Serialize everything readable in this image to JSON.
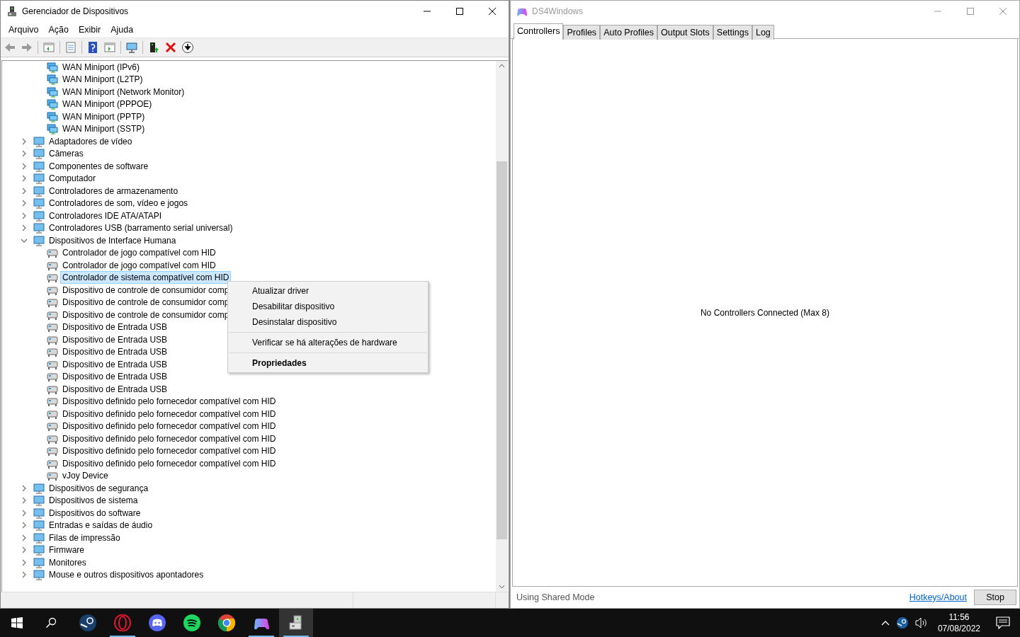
{
  "device_manager": {
    "title": "Gerenciador de Dispositivos",
    "menu": [
      "Arquivo",
      "Ação",
      "Exibir",
      "Ajuda"
    ],
    "tree": [
      {
        "children": [
          {
            "label": "WAN Miniport (IPv6)",
            "selected": false
          },
          {
            "label": "WAN Miniport (L2TP)",
            "selected": false
          },
          {
            "label": "WAN Miniport (Network Monitor)",
            "selected": false
          },
          {
            "label": "WAN Miniport (PPPOE)",
            "selected": false
          },
          {
            "label": "WAN Miniport (PPTP)",
            "selected": false
          },
          {
            "label": "WAN Miniport (SSTP)",
            "selected": false
          }
        ]
      },
      {
        "label": "Adaptadores de vídeo",
        "expanded": false,
        "selected": false
      },
      {
        "label": "Câmeras",
        "expanded": false,
        "selected": false
      },
      {
        "label": "Componentes de software",
        "expanded": false,
        "selected": false
      },
      {
        "label": "Computador",
        "expanded": false,
        "selected": false
      },
      {
        "label": "Controladores de armazenamento",
        "expanded": false,
        "selected": false
      },
      {
        "label": "Controladores de som, vídeo e jogos",
        "expanded": false,
        "selected": false
      },
      {
        "label": "Controladores IDE ATA/ATAPI",
        "expanded": false,
        "selected": false
      },
      {
        "label": "Controladores USB (barramento serial universal)",
        "expanded": false,
        "selected": false
      },
      {
        "label": "Dispositivos de Interface Humana",
        "expanded": true,
        "selected": false,
        "children": [
          {
            "label": "Controlador de jogo compatível com HID",
            "selected": false
          },
          {
            "label": "Controlador de jogo compatível com HID",
            "selected": false
          },
          {
            "label": "Controlador de sistema compatível com HID",
            "selected": true
          },
          {
            "label": "Dispositivo de controle de consumidor comp",
            "selected": false
          },
          {
            "label": "Dispositivo de controle de consumidor comp",
            "selected": false
          },
          {
            "label": "Dispositivo de controle de consumidor comp",
            "selected": false
          },
          {
            "label": "Dispositivo de Entrada USB",
            "selected": false
          },
          {
            "label": "Dispositivo de Entrada USB",
            "selected": false
          },
          {
            "label": "Dispositivo de Entrada USB",
            "selected": false
          },
          {
            "label": "Dispositivo de Entrada USB",
            "selected": false
          },
          {
            "label": "Dispositivo de Entrada USB",
            "selected": false
          },
          {
            "label": "Dispositivo de Entrada USB",
            "selected": false
          },
          {
            "label": "Dispositivo definido pelo fornecedor compatível com HID",
            "selected": false
          },
          {
            "label": "Dispositivo definido pelo fornecedor compatível com HID",
            "selected": false
          },
          {
            "label": "Dispositivo definido pelo fornecedor compatível com HID",
            "selected": false
          },
          {
            "label": "Dispositivo definido pelo fornecedor compatível com HID",
            "selected": false
          },
          {
            "label": "Dispositivo definido pelo fornecedor compatível com HID",
            "selected": false
          },
          {
            "label": "Dispositivo definido pelo fornecedor compatível com HID",
            "selected": false
          },
          {
            "label": "vJoy Device",
            "selected": false
          }
        ]
      },
      {
        "label": "Dispositivos de segurança",
        "expanded": false,
        "selected": false
      },
      {
        "label": "Dispositivos de sistema",
        "expanded": false,
        "selected": false
      },
      {
        "label": "Dispositivos do software",
        "expanded": false,
        "selected": false
      },
      {
        "label": "Entradas e saídas de áudio",
        "expanded": false,
        "selected": false
      },
      {
        "label": "Filas de impressão",
        "expanded": false,
        "selected": false
      },
      {
        "label": "Firmware",
        "expanded": false,
        "selected": false
      },
      {
        "label": "Monitores",
        "expanded": false,
        "selected": false
      },
      {
        "label": "Mouse e outros dispositivos apontadores",
        "expanded": false,
        "selected": false
      }
    ],
    "context_menu": [
      {
        "kind": "item",
        "label": "Atualizar driver",
        "default": false
      },
      {
        "kind": "item",
        "label": "Desabilitar dispositivo",
        "default": false
      },
      {
        "kind": "item",
        "label": "Desinstalar dispositivo",
        "default": false
      },
      {
        "kind": "separator"
      },
      {
        "kind": "item",
        "label": "Verificar se há alterações de hardware",
        "default": false
      },
      {
        "kind": "separator"
      },
      {
        "kind": "item",
        "label": "Propriedades",
        "default": true
      }
    ]
  },
  "ds4windows": {
    "title": "DS4Windows",
    "tabs": [
      {
        "label": "Controllers",
        "selected": true
      },
      {
        "label": "Profiles",
        "selected": false
      },
      {
        "label": "Auto Profiles",
        "selected": false
      },
      {
        "label": "Output Slots",
        "selected": false
      },
      {
        "label": "Settings",
        "selected": false
      },
      {
        "label": "Log",
        "selected": false
      }
    ],
    "message": "No Controllers Connected (Max 8)",
    "status": "Using Shared Mode",
    "link": "Hotkeys/About",
    "button": "Stop"
  },
  "taskbar": {
    "apps": [
      {
        "kind": "steam",
        "running": false,
        "active": false
      },
      {
        "kind": "opera",
        "running": true,
        "active": false
      },
      {
        "kind": "discord",
        "running": false,
        "active": false
      },
      {
        "kind": "spotify",
        "running": false,
        "active": false
      },
      {
        "kind": "chrome",
        "running": false,
        "active": false
      },
      {
        "kind": "gamepad",
        "running": true,
        "active": false
      },
      {
        "kind": "device-manager",
        "running": true,
        "active": true
      }
    ],
    "time": "11:56",
    "date": "07/08/2022"
  }
}
